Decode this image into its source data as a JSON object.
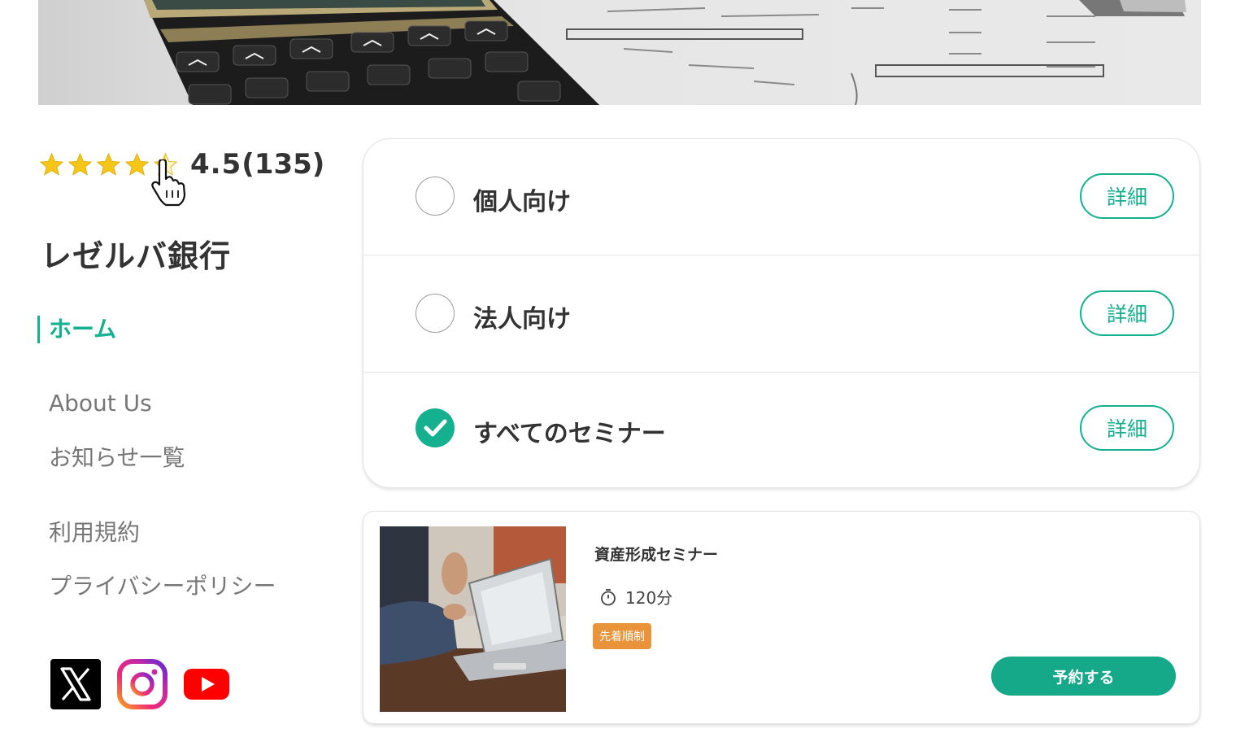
{
  "rating": {
    "value": "4.5",
    "count": "135",
    "stars": 4.5
  },
  "bank": {
    "name": "レゼルバ銀行"
  },
  "nav": {
    "home": "ホーム",
    "about": "About Us",
    "news": "お知らせ一覧",
    "terms": "利用規約",
    "privacy": "プライバシーポリシー"
  },
  "social": {
    "icons": [
      "x-icon",
      "instagram-icon",
      "youtube-icon"
    ]
  },
  "options": [
    {
      "label": "個人向け",
      "checked": false,
      "detail": "詳細"
    },
    {
      "label": "法人向け",
      "checked": false,
      "detail": "詳細"
    },
    {
      "label": "すべてのセミナー",
      "checked": true,
      "detail": "詳細"
    }
  ],
  "seminar": {
    "title": "資産形成セミナー",
    "duration": "120分",
    "badge": "先着順制",
    "reserve": "予約する"
  },
  "colors": {
    "accent": "#15b090",
    "badge": "#e9943a",
    "text": "#333333",
    "muted": "#777777"
  }
}
